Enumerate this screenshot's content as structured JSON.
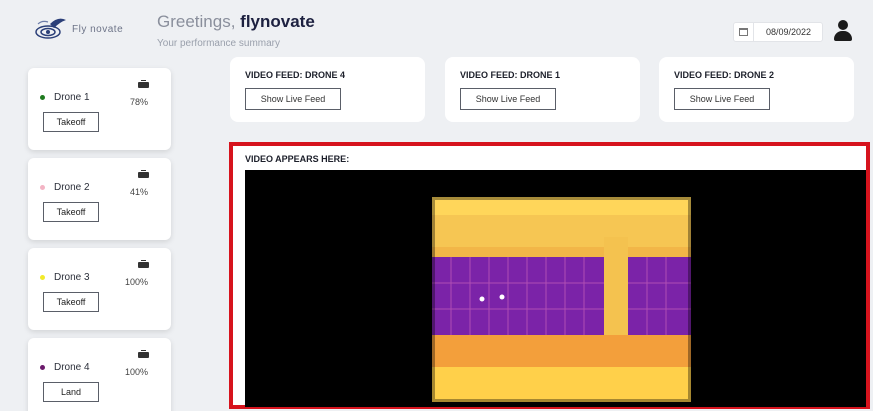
{
  "brand": {
    "logo_text": "Fly novate"
  },
  "header": {
    "greeting_prefix": "Greetings, ",
    "greeting_name": "flynovate",
    "subtitle": "Your performance summary",
    "date": "08/09/2022"
  },
  "drones": [
    {
      "name": "Drone 1",
      "battery": "78%",
      "action": "Takeoff",
      "dot_color": "#1f7a1f"
    },
    {
      "name": "Drone 2",
      "battery": "41%",
      "action": "Takeoff",
      "dot_color": "#f3b4c4"
    },
    {
      "name": "Drone 3",
      "battery": "100%",
      "action": "Takeoff",
      "dot_color": "#f2ea2a"
    },
    {
      "name": "Drone 4",
      "battery": "100%",
      "action": "Land",
      "dot_color": "#6b1a6b"
    }
  ],
  "feeds": [
    {
      "title": "VIDEO FEED: DRONE 4",
      "button": "Show Live Feed"
    },
    {
      "title": "VIDEO FEED: DRONE 1",
      "button": "Show Live Feed"
    },
    {
      "title": "VIDEO FEED: DRONE 2",
      "button": "Show Live Feed"
    }
  ],
  "video": {
    "label": "VIDEO APPEARS HERE:",
    "frame_color": "#d6131d"
  }
}
